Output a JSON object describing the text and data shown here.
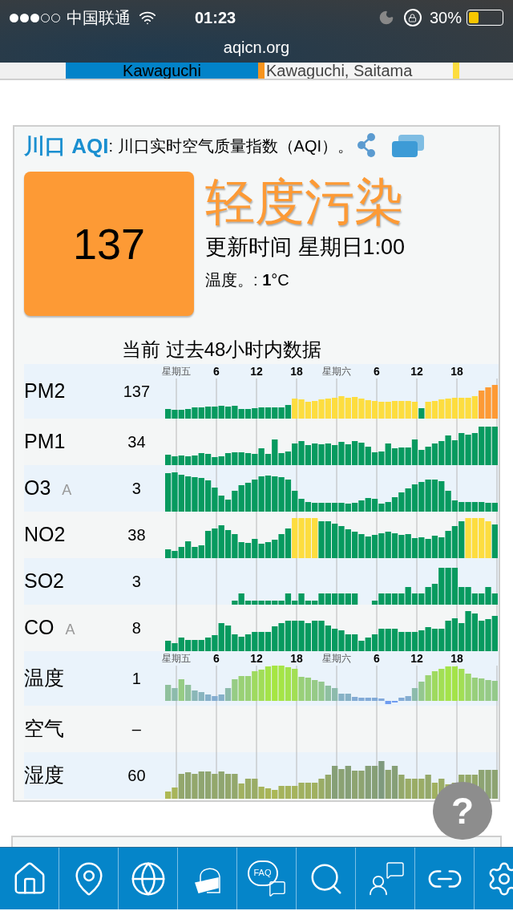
{
  "status_bar": {
    "carrier": "中国联通",
    "time": "01:23",
    "battery_text": "30%",
    "battery": {
      "level": 0.3
    },
    "url": "aqicn.org"
  },
  "tabs": [
    {
      "label": "Kawaguchi",
      "selected": true,
      "color": "#f7941d"
    },
    {
      "label": "Kawaguchi, Saitama",
      "selected": false,
      "color": "#fddd3f"
    }
  ],
  "card": {
    "title": "川口 AQI",
    "description": ": 川口实时空气质量指数（AQI）。",
    "aqi": {
      "value": "137",
      "color": "#fd9a35"
    },
    "level_text": "轻度污染",
    "updated": "更新时间 星期日1:00",
    "temperature_label": "温度。: ",
    "temperature_value": "1",
    "temperature_unit": "°C",
    "history_title": "当前 过去48小时内数据",
    "rows": [
      {
        "name": "PM2",
        "value": "137",
        "axis_labels": [
          {
            "text": "星期五",
            "kind": "day"
          },
          {
            "text": "6",
            "kind": "hour"
          },
          {
            "text": "12",
            "kind": "hour"
          },
          {
            "text": "18",
            "kind": "hour"
          },
          {
            "text": "星期六",
            "kind": "day"
          },
          {
            "text": "6",
            "kind": "hour"
          },
          {
            "text": "12",
            "kind": "hour"
          },
          {
            "text": "18",
            "kind": "hour"
          }
        ]
      },
      {
        "name": "PM1",
        "value": "34"
      },
      {
        "name": "O3",
        "sub": "A",
        "value": "3"
      },
      {
        "name": "NO2",
        "value": "38"
      },
      {
        "name": "SO2",
        "value": "3"
      },
      {
        "name": "CO",
        "sub": "A",
        "value": "8"
      },
      {
        "name": "温度",
        "value": "1",
        "axis_labels": [
          {
            "text": "星期五",
            "kind": "day"
          },
          {
            "text": "6",
            "kind": "hour"
          },
          {
            "text": "12",
            "kind": "hour"
          },
          {
            "text": "18",
            "kind": "hour"
          },
          {
            "text": "星期六",
            "kind": "day"
          },
          {
            "text": "6",
            "kind": "hour"
          },
          {
            "text": "12",
            "kind": "hour"
          },
          {
            "text": "18",
            "kind": "hour"
          }
        ]
      },
      {
        "name": "空气",
        "value": "–"
      },
      {
        "name": "湿度",
        "value": "60"
      }
    ]
  },
  "help_button": {
    "label": "?"
  },
  "nav": [
    {
      "kind": "home"
    },
    {
      "kind": "location"
    },
    {
      "kind": "globe"
    },
    {
      "kind": "mask"
    },
    {
      "kind": "faq",
      "label": "FAQ"
    },
    {
      "kind": "search"
    },
    {
      "kind": "chat"
    },
    {
      "kind": "link"
    },
    {
      "kind": "settings"
    }
  ]
}
